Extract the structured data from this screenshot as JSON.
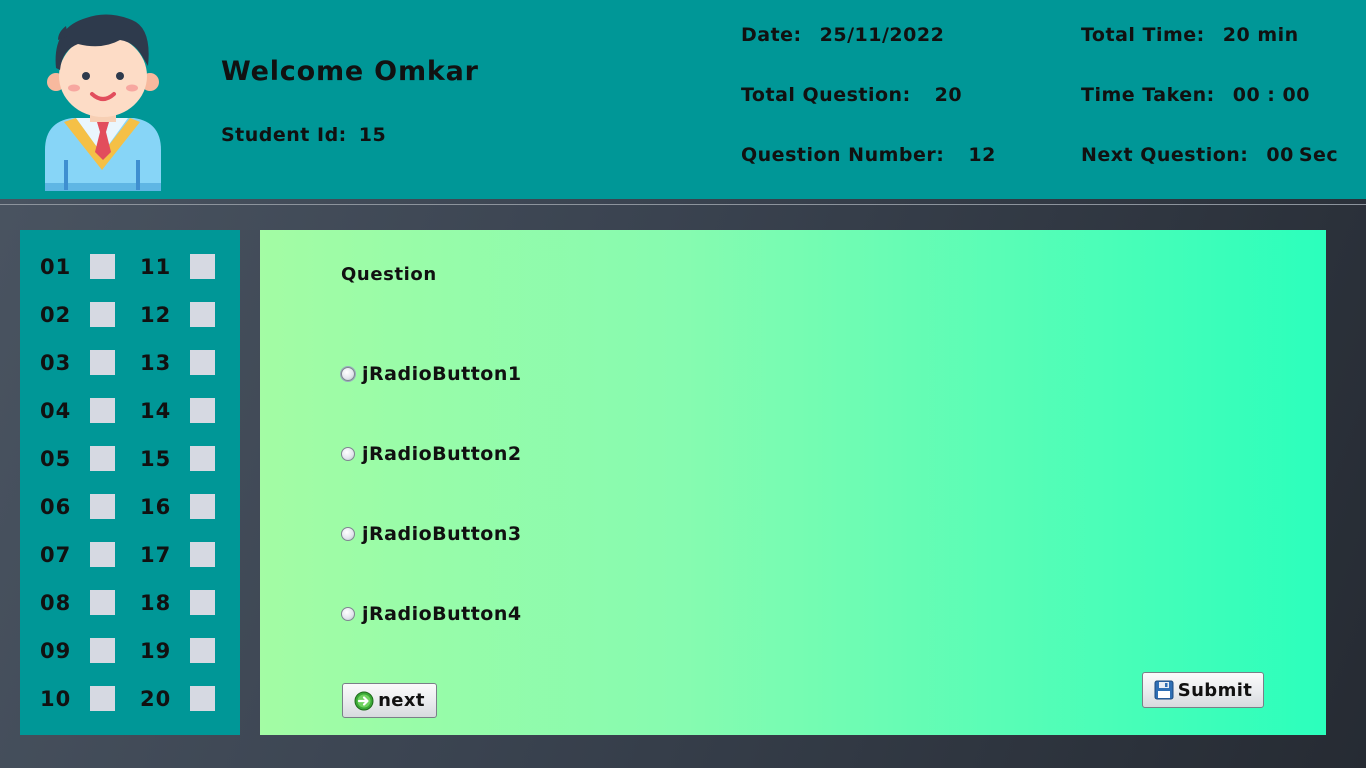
{
  "header": {
    "welcome": "Welcome Omkar",
    "student_id_label": "Student Id:",
    "student_id": "15",
    "date_label": "Date:",
    "date": "25/11/2022",
    "total_question_label": "Total Question:",
    "total_question": "20",
    "question_number_label": "Question Number:",
    "question_number": "12",
    "total_time_label": "Total Time:",
    "total_time": "20 min",
    "time_taken_label": "Time Taken:",
    "time_taken": "00 : 00",
    "next_question_label": "Next Question:",
    "next_question": "00",
    "next_question_unit": "Sec"
  },
  "nav": {
    "left": [
      "01",
      "02",
      "03",
      "04",
      "05",
      "06",
      "07",
      "08",
      "09",
      "10"
    ],
    "right": [
      "11",
      "12",
      "13",
      "14",
      "15",
      "16",
      "17",
      "18",
      "19",
      "20"
    ]
  },
  "question": {
    "label": "Question",
    "options": [
      "jRadioButton1",
      "jRadioButton2",
      "jRadioButton3",
      "jRadioButton4"
    ]
  },
  "buttons": {
    "next": "next",
    "submit": "Submit"
  },
  "colors": {
    "header_bg": "#009797",
    "nav_bg": "#009797",
    "status_box": "#d6d9e2",
    "question_gradient_start": "#a3fca4",
    "question_gradient_end": "#2bffbc"
  },
  "icons": {
    "avatar": "student-avatar",
    "next": "arrow-right-circle-icon",
    "submit": "floppy-disk-icon"
  }
}
